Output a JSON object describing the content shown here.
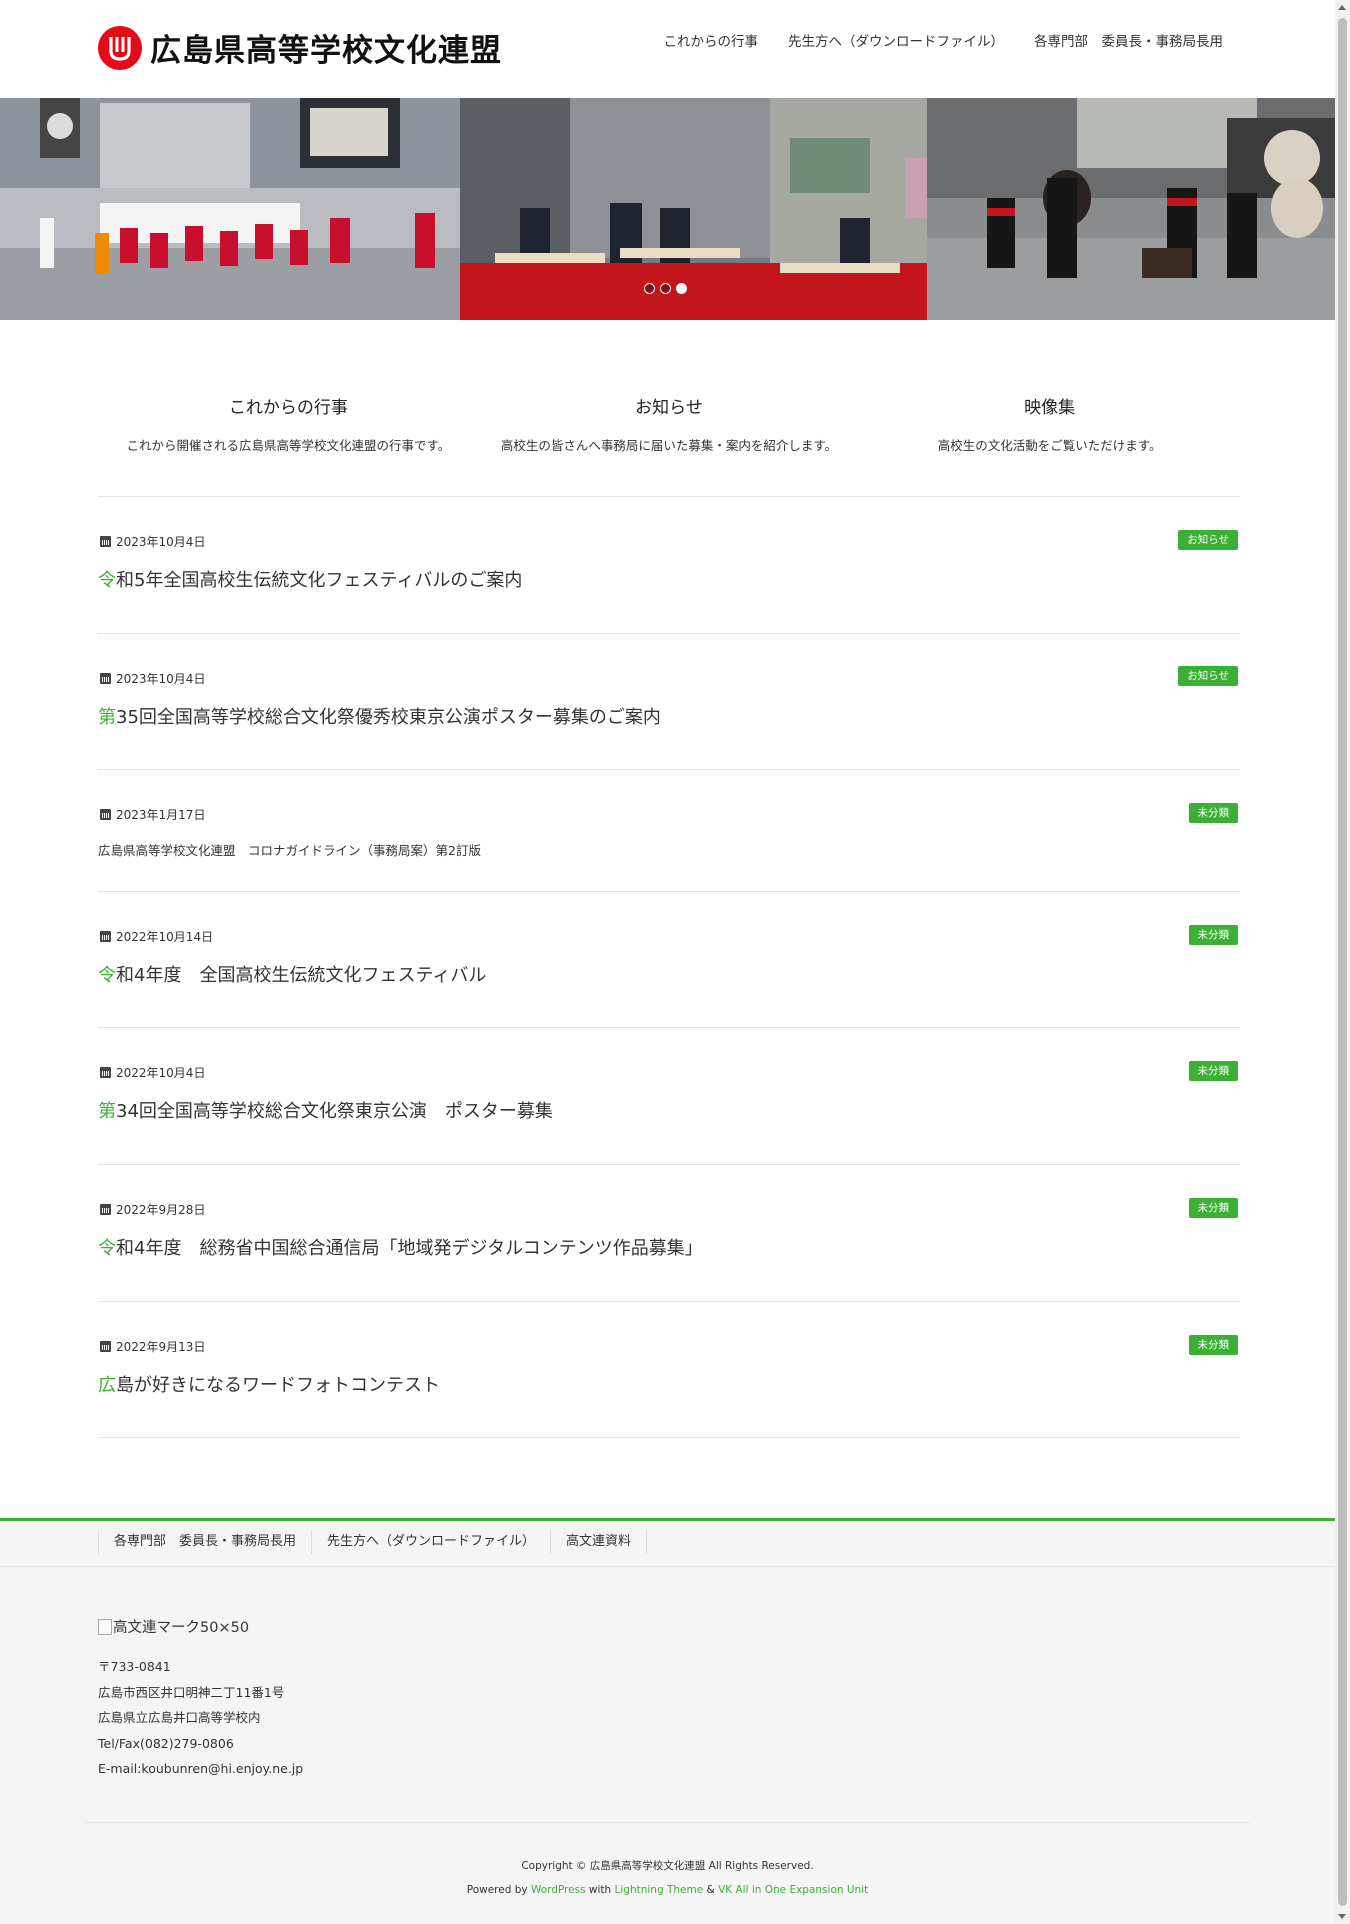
{
  "site": {
    "title": "広島県高等学校文化連盟",
    "accent_color": "#3cb034",
    "logo_color": "#e30b17"
  },
  "header_nav": [
    {
      "label": "これからの行事"
    },
    {
      "label": "先生方へ（ダウンロードファイル）"
    },
    {
      "label": "各専門部　委員長・事務局長用"
    }
  ],
  "slider": {
    "dots": 3,
    "active_dot": 3
  },
  "features": [
    {
      "title": "これからの行事",
      "desc": "これから開催される広島県高等学校文化連盟の行事です。"
    },
    {
      "title": "お知らせ",
      "desc": "高校生の皆さんへ事務局に届いた募集・案内を紹介します。"
    },
    {
      "title": "映像集",
      "desc": "高校生の文化活動をご覧いただけます。"
    }
  ],
  "posts": [
    {
      "date": "2023年10月4日",
      "badge": "お知らせ",
      "first": "令",
      "rest": "和5年全国高校生伝統文化フェスティバルのご案内"
    },
    {
      "date": "2023年10月4日",
      "badge": "お知らせ",
      "first": "第",
      "rest": "35回全国高等学校総合文化祭優秀校東京公演ポスター募集のご案内"
    },
    {
      "date": "2023年1月17日",
      "badge": "未分類",
      "first": "",
      "rest": "広島県高等学校文化連盟　コロナガイドライン（事務局案）第2訂版"
    },
    {
      "date": "2022年10月14日",
      "badge": "未分類",
      "first": "令",
      "rest": "和4年度　全国高校生伝統文化フェスティバル"
    },
    {
      "date": "2022年10月4日",
      "badge": "未分類",
      "first": "第",
      "rest": "34回全国高等学校総合文化祭東京公演　ポスター募集"
    },
    {
      "date": "2022年9月28日",
      "badge": "未分類",
      "first": "令",
      "rest": "和4年度　総務省中国総合通信局「地域発デジタルコンテンツ作品募集」"
    },
    {
      "date": "2022年9月13日",
      "badge": "未分類",
      "first": "広",
      "rest": "島が好きになるワードフォトコンテスト"
    }
  ],
  "footer_nav": [
    {
      "label": "各専門部　委員長・事務局長用"
    },
    {
      "label": "先生方へ（ダウンロードファイル）"
    },
    {
      "label": "高文連資料"
    }
  ],
  "footer": {
    "logo_alt": "高文連マーク50×50",
    "address": [
      "〒733-0841",
      "広島市西区井口明神二丁11番1号",
      "広島県立広島井口高等学校内",
      "Tel/Fax(082)279-0806",
      "E-mail:koubunren@hi.enjoy.ne.jp"
    ],
    "copyright": "Copyright © 広島県高等学校文化連盟 All Rights Reserved.",
    "powered_prefix": "Powered by ",
    "powered_wp": "WordPress",
    "powered_with": " with ",
    "powered_theme": "Lightning Theme",
    "powered_amp": " & ",
    "powered_vk": "VK All in One Expansion Unit"
  }
}
